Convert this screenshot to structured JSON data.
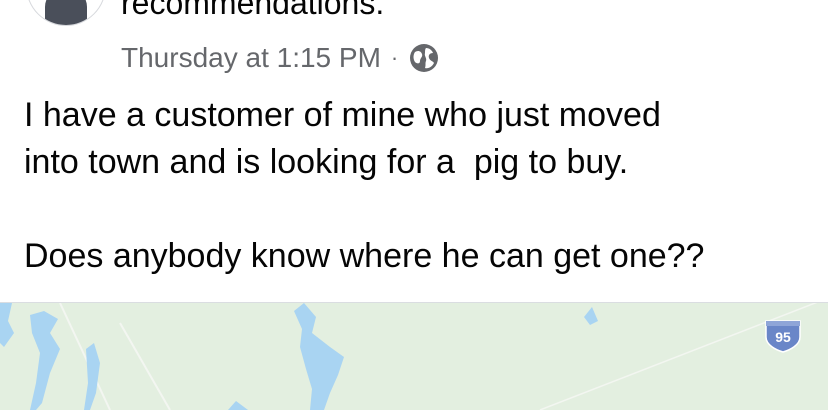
{
  "post": {
    "header_text": "recommendations.",
    "timestamp": "Thursday at 1:15 PM",
    "separator": "·",
    "audience_icon": "globe-icon",
    "body_text": "I have a customer of mine who just moved\ninto town and is looking for a  pig to buy.\n\nDoes anybody know where he can get one??"
  },
  "map": {
    "highway_shield_label": "95",
    "colors": {
      "land": "#e3efe0",
      "water": "#a9d4f2",
      "shield": "#6a86c8"
    }
  }
}
